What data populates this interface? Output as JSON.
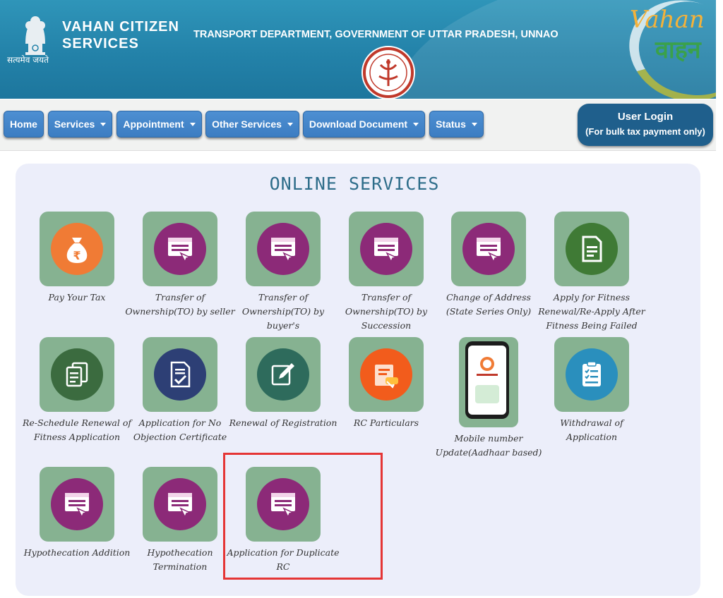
{
  "header": {
    "emblem_motto": "सत्यमेव जयते",
    "site_title": "VAHAN CITIZEN SERVICES",
    "department": "TRANSPORT DEPARTMENT, GOVERNMENT OF UTTAR PRADESH, UNNAO",
    "logo_text_en": "Vahan",
    "logo_text_hi": "वाहन"
  },
  "nav": {
    "items": [
      {
        "label": "Home",
        "dropdown": false
      },
      {
        "label": "Services",
        "dropdown": true
      },
      {
        "label": "Appointment",
        "dropdown": true
      },
      {
        "label": "Other Services",
        "dropdown": true
      },
      {
        "label": "Download Document",
        "dropdown": true
      },
      {
        "label": "Status",
        "dropdown": true
      }
    ],
    "login_label": "User Login",
    "login_sub": "(For bulk tax payment only)"
  },
  "panel": {
    "title": "ONLINE SERVICES",
    "tiles": [
      {
        "label": "Pay Your Tax",
        "icon": "money-bag-icon"
      },
      {
        "label": "Transfer of Ownership(TO) by seller",
        "icon": "web-form-icon"
      },
      {
        "label": "Transfer of Ownership(TO) by buyer's",
        "icon": "web-form-icon"
      },
      {
        "label": "Transfer of Ownership(TO) by Succession",
        "icon": "web-form-icon"
      },
      {
        "label": "Change of Address (State Series Only)",
        "icon": "web-form-icon"
      },
      {
        "label": "Apply for Fitness Renewal/Re-Apply After Fitness Being Failed",
        "icon": "document-icon"
      },
      {
        "label": "Re-Schedule Renewal of Fitness Application",
        "icon": "documents-icon"
      },
      {
        "label": "Application for No Objection Certificate",
        "icon": "certificate-icon"
      },
      {
        "label": "Renewal of Registration",
        "icon": "edit-icon"
      },
      {
        "label": "RC Particulars",
        "icon": "rc-card-icon"
      },
      {
        "label": "Mobile number Update(Aadhaar based)",
        "icon": "mobile-phone-icon"
      },
      {
        "label": "Withdrawal of Application",
        "icon": "clipboard-icon"
      },
      {
        "label": "Hypothecation Addition",
        "icon": "web-form-icon"
      },
      {
        "label": "Hypothecation Termination",
        "icon": "web-form-icon"
      },
      {
        "label": "Application for Duplicate RC",
        "icon": "web-form-icon"
      }
    ]
  },
  "colors": {
    "header_bg": "#2382a9",
    "nav_button": "#3c7dc2",
    "login_button": "#1f5f8c",
    "tile_bg": "#86b291",
    "panel_bg": "#eceefa",
    "title_color": "#2e6d8a",
    "purple_circle": "#8c2a78",
    "highlight_border": "#e53535"
  }
}
